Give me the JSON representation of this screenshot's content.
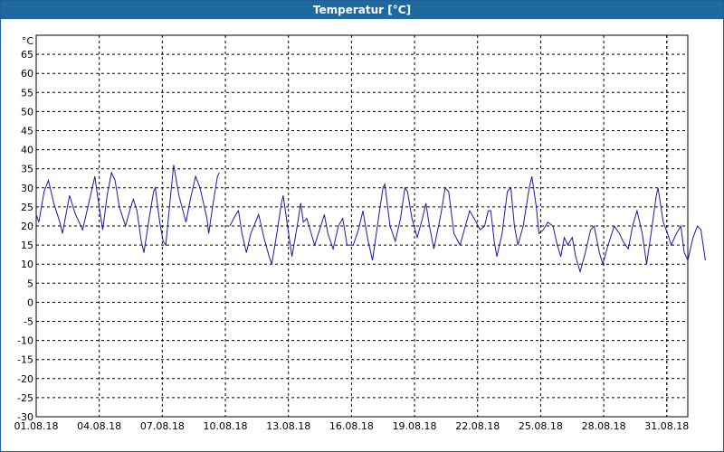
{
  "window": {
    "title": "Temperatur [°C]"
  },
  "colors": {
    "titlebar": "#1e6aa0",
    "line": "#1a1aa0",
    "grid": "#000000"
  },
  "chart_data": {
    "type": "line",
    "title": "Temperatur [°C]",
    "ylabel": "°C",
    "xlabel": "",
    "ylim": [
      -30,
      70
    ],
    "xlim": [
      "2018-08-01",
      "2018-08-01"
    ],
    "grid": true,
    "yticks": [
      "65",
      "60",
      "55",
      "50",
      "45",
      "40",
      "35",
      "30",
      "25",
      "20",
      "15",
      "10",
      "5",
      "0",
      "-5",
      "-10",
      "-15",
      "-20",
      "-25",
      "-30"
    ],
    "xticks": [
      "01.08.18",
      "04.08.18",
      "07.08.18",
      "10.08.18",
      "13.08.18",
      "16.08.18",
      "19.08.18",
      "22.08.18",
      "25.08.18",
      "28.08.18",
      "31.08.18"
    ],
    "xstart": "2018-08-01",
    "xend": "2018-09-01",
    "series": [
      {
        "values": [
          {
            "x": "2018-08-01 00:00",
            "y": 23
          },
          {
            "x": "2018-08-01 03:00",
            "y": 21
          },
          {
            "x": "2018-08-01 09:00",
            "y": 29
          },
          {
            "x": "2018-08-01 14:00",
            "y": 32
          },
          {
            "x": "2018-08-01 20:00",
            "y": 26
          },
          {
            "x": "2018-08-02 03:00",
            "y": 21
          },
          {
            "x": "2018-08-02 06:00",
            "y": 18
          },
          {
            "x": "2018-08-02 14:00",
            "y": 28
          },
          {
            "x": "2018-08-02 21:00",
            "y": 23
          },
          {
            "x": "2018-08-03 05:00",
            "y": 19
          },
          {
            "x": "2018-08-03 15:00",
            "y": 29
          },
          {
            "x": "2018-08-03 19:00",
            "y": 33
          },
          {
            "x": "2018-08-03 22:00",
            "y": 28
          },
          {
            "x": "2018-08-04 04:00",
            "y": 19
          },
          {
            "x": "2018-08-04 09:00",
            "y": 28
          },
          {
            "x": "2018-08-04 14:00",
            "y": 34
          },
          {
            "x": "2018-08-04 18:00",
            "y": 32
          },
          {
            "x": "2018-08-04 23:00",
            "y": 25
          },
          {
            "x": "2018-08-05 06:00",
            "y": 20
          },
          {
            "x": "2018-08-05 12:00",
            "y": 25
          },
          {
            "x": "2018-08-05 15:00",
            "y": 27
          },
          {
            "x": "2018-08-05 19:00",
            "y": 24
          },
          {
            "x": "2018-08-06 00:00",
            "y": 16
          },
          {
            "x": "2018-08-06 03:00",
            "y": 13
          },
          {
            "x": "2018-08-06 09:00",
            "y": 22
          },
          {
            "x": "2018-08-06 14:00",
            "y": 29
          },
          {
            "x": "2018-08-06 16:00",
            "y": 30
          },
          {
            "x": "2018-08-06 21:00",
            "y": 21
          },
          {
            "x": "2018-08-07 01:00",
            "y": 16
          },
          {
            "x": "2018-08-07 04:00",
            "y": 15
          },
          {
            "x": "2018-08-07 09:00",
            "y": 27
          },
          {
            "x": "2018-08-07 13:00",
            "y": 36
          },
          {
            "x": "2018-08-07 19:00",
            "y": 28
          },
          {
            "x": "2018-08-08 03:00",
            "y": 21
          },
          {
            "x": "2018-08-08 08:00",
            "y": 27
          },
          {
            "x": "2018-08-08 14:00",
            "y": 33
          },
          {
            "x": "2018-08-08 19:00",
            "y": 30
          },
          {
            "x": "2018-08-09 03:00",
            "y": 22
          },
          {
            "x": "2018-08-09 05:00",
            "y": 18
          },
          {
            "x": "2018-08-09 10:00",
            "y": 26
          },
          {
            "x": "2018-08-09 15:00",
            "y": 33
          },
          {
            "x": "2018-08-09 17:00",
            "y": 34
          },
          null,
          {
            "x": "2018-08-10 05:00",
            "y": 20
          },
          {
            "x": "2018-08-10 12:00",
            "y": 23
          },
          {
            "x": "2018-08-10 15:00",
            "y": 24
          },
          {
            "x": "2018-08-10 19:00",
            "y": 18
          },
          {
            "x": "2018-08-11 00:00",
            "y": 13
          },
          {
            "x": "2018-08-11 05:00",
            "y": 18
          },
          {
            "x": "2018-08-11 14:00",
            "y": 23
          },
          {
            "x": "2018-08-11 20:00",
            "y": 17
          },
          {
            "x": "2018-08-12 02:00",
            "y": 12
          },
          {
            "x": "2018-08-12 05:00",
            "y": 10
          },
          {
            "x": "2018-08-12 10:00",
            "y": 17
          },
          {
            "x": "2018-08-12 16:00",
            "y": 26
          },
          {
            "x": "2018-08-12 18:00",
            "y": 28
          },
          {
            "x": "2018-08-12 23:00",
            "y": 20
          },
          {
            "x": "2018-08-13 04:00",
            "y": 12
          },
          {
            "x": "2018-08-13 10:00",
            "y": 20
          },
          {
            "x": "2018-08-13 14:00",
            "y": 26
          },
          {
            "x": "2018-08-13 17:00",
            "y": 21
          },
          {
            "x": "2018-08-13 21:00",
            "y": 22
          },
          {
            "x": "2018-08-14 02:00",
            "y": 18
          },
          {
            "x": "2018-08-14 06:00",
            "y": 15
          },
          {
            "x": "2018-08-14 13:00",
            "y": 20
          },
          {
            "x": "2018-08-14 17:00",
            "y": 23
          },
          {
            "x": "2018-08-14 21:00",
            "y": 18
          },
          {
            "x": "2018-08-15 03:00",
            "y": 14
          },
          {
            "x": "2018-08-15 09:00",
            "y": 20
          },
          {
            "x": "2018-08-15 14:00",
            "y": 22
          },
          {
            "x": "2018-08-15 19:00",
            "y": 15
          },
          {
            "x": "2018-08-16 02:00",
            "y": 15
          },
          {
            "x": "2018-08-16 08:00",
            "y": 19
          },
          {
            "x": "2018-08-16 13:00",
            "y": 24
          },
          {
            "x": "2018-08-16 19:00",
            "y": 16
          },
          {
            "x": "2018-08-17 00:00",
            "y": 11
          },
          {
            "x": "2018-08-17 08:00",
            "y": 24
          },
          {
            "x": "2018-08-17 12:00",
            "y": 30
          },
          {
            "x": "2018-08-17 14:00",
            "y": 31
          },
          {
            "x": "2018-08-17 20:00",
            "y": 20
          },
          {
            "x": "2018-08-18 02:00",
            "y": 16
          },
          {
            "x": "2018-08-18 08:00",
            "y": 22
          },
          {
            "x": "2018-08-18 13:00",
            "y": 30
          },
          {
            "x": "2018-08-18 16:00",
            "y": 29
          },
          {
            "x": "2018-08-18 21:00",
            "y": 22
          },
          {
            "x": "2018-08-19 03:00",
            "y": 17
          },
          {
            "x": "2018-08-19 09:00",
            "y": 22
          },
          {
            "x": "2018-08-19 13:00",
            "y": 26
          },
          {
            "x": "2018-08-19 17:00",
            "y": 20
          },
          {
            "x": "2018-08-19 22:00",
            "y": 14
          },
          {
            "x": "2018-08-20 06:00",
            "y": 23
          },
          {
            "x": "2018-08-20 11:00",
            "y": 30
          },
          {
            "x": "2018-08-20 15:00",
            "y": 29
          },
          {
            "x": "2018-08-20 21:00",
            "y": 18
          },
          {
            "x": "2018-08-21 04:00",
            "y": 15
          },
          {
            "x": "2018-08-21 10:00",
            "y": 20
          },
          {
            "x": "2018-08-21 15:00",
            "y": 24
          },
          {
            "x": "2018-08-21 20:00",
            "y": 22
          },
          {
            "x": "2018-08-22 03:00",
            "y": 19
          },
          {
            "x": "2018-08-22 08:00",
            "y": 20
          },
          {
            "x": "2018-08-22 12:00",
            "y": 24
          },
          {
            "x": "2018-08-22 15:00",
            "y": 24
          },
          {
            "x": "2018-08-22 19:00",
            "y": 16
          },
          {
            "x": "2018-08-22 22:00",
            "y": 12
          },
          {
            "x": "2018-08-23 04:00",
            "y": 18
          },
          {
            "x": "2018-08-23 10:00",
            "y": 29
          },
          {
            "x": "2018-08-23 14:00",
            "y": 30
          },
          {
            "x": "2018-08-23 18:00",
            "y": 20
          },
          {
            "x": "2018-08-23 22:00",
            "y": 15
          },
          {
            "x": "2018-08-24 04:00",
            "y": 20
          },
          {
            "x": "2018-08-24 11:00",
            "y": 30
          },
          {
            "x": "2018-08-24 14:00",
            "y": 33
          },
          {
            "x": "2018-08-24 19:00",
            "y": 25
          },
          {
            "x": "2018-08-24 22:00",
            "y": 18
          },
          {
            "x": "2018-08-25 03:00",
            "y": 19
          },
          {
            "x": "2018-08-25 08:00",
            "y": 21
          },
          {
            "x": "2018-08-25 14:00",
            "y": 20
          },
          {
            "x": "2018-08-25 19:00",
            "y": 15
          },
          {
            "x": "2018-08-25 23:00",
            "y": 12
          },
          {
            "x": "2018-08-26 03:00",
            "y": 17
          },
          {
            "x": "2018-08-26 07:00",
            "y": 15
          },
          {
            "x": "2018-08-26 12:00",
            "y": 17
          },
          {
            "x": "2018-08-26 16:00",
            "y": 12
          },
          {
            "x": "2018-08-26 21:00",
            "y": 8
          },
          {
            "x": "2018-08-27 03:00",
            "y": 13
          },
          {
            "x": "2018-08-27 09:00",
            "y": 19
          },
          {
            "x": "2018-08-27 13:00",
            "y": 20
          },
          {
            "x": "2018-08-27 19:00",
            "y": 13
          },
          {
            "x": "2018-08-27 23:00",
            "y": 10
          },
          {
            "x": "2018-08-28 05:00",
            "y": 15
          },
          {
            "x": "2018-08-28 12:00",
            "y": 20
          },
          {
            "x": "2018-08-28 18:00",
            "y": 18
          },
          {
            "x": "2018-08-28 22:00",
            "y": 16
          },
          {
            "x": "2018-08-29 04:00",
            "y": 14
          },
          {
            "x": "2018-08-29 09:00",
            "y": 20
          },
          {
            "x": "2018-08-29 14:00",
            "y": 24
          },
          {
            "x": "2018-08-29 20:00",
            "y": 18
          },
          {
            "x": "2018-08-30 01:00",
            "y": 10
          },
          {
            "x": "2018-08-30 06:00",
            "y": 18
          },
          {
            "x": "2018-08-30 12:00",
            "y": 28
          },
          {
            "x": "2018-08-30 14:00",
            "y": 30
          },
          {
            "x": "2018-08-30 20:00",
            "y": 21
          },
          {
            "x": "2018-08-31 01:00",
            "y": 18
          },
          {
            "x": "2018-08-31 05:00",
            "y": 15
          },
          {
            "x": "2018-08-31 11:00",
            "y": 18
          },
          {
            "x": "2018-08-31 16:00",
            "y": 20
          },
          {
            "x": "2018-08-31 20:00",
            "y": 13
          },
          {
            "x": "2018-09-01 00:00",
            "y": 11
          },
          {
            "x": "2018-09-01 06:00",
            "y": 17
          },
          {
            "x": "2018-09-01 11:00",
            "y": 20
          },
          {
            "x": "2018-09-01 15:00",
            "y": 19
          },
          {
            "x": "2018-09-01 20:00",
            "y": 11
          }
        ]
      }
    ]
  }
}
